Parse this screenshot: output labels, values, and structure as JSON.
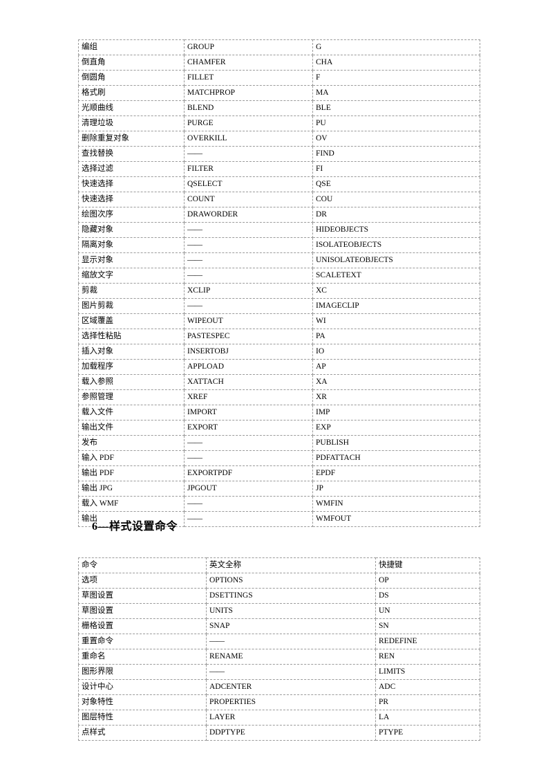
{
  "document": {
    "page_background": "#ffffff",
    "border_color": "#9a9a9a",
    "text_color": "#000000",
    "empty_cell_marker": "——"
  },
  "table_one": {
    "name": "continued-command-table",
    "columns": [
      "command_cn",
      "english_full_name",
      "shortcut"
    ],
    "rows": [
      {
        "cn": "编组",
        "en": "GROUP",
        "key": "G"
      },
      {
        "cn": "倒直角",
        "en": "CHAMFER",
        "key": "CHA"
      },
      {
        "cn": "倒圆角",
        "en": "FILLET",
        "key": "F"
      },
      {
        "cn": "格式刷",
        "en": "MATCHPROP",
        "key": "MA"
      },
      {
        "cn": "光顺曲线",
        "en": "BLEND",
        "key": "BLE"
      },
      {
        "cn": "清理垃圾",
        "en": "PURGE",
        "key": "PU"
      },
      {
        "cn": "删除重复对象",
        "en": "OVERKILL",
        "key": "OV"
      },
      {
        "cn": "查找替换",
        "en": "——",
        "key": "FIND"
      },
      {
        "cn": "选择过滤",
        "en": "FILTER",
        "key": "FI"
      },
      {
        "cn": "快速选择",
        "en": "QSELECT",
        "key": "QSE"
      },
      {
        "cn": "快速选择",
        "en": "COUNT",
        "key": "COU"
      },
      {
        "cn": "绘图次序",
        "en": "DRAWORDER",
        "key": "DR"
      },
      {
        "cn": "隐藏对象",
        "en": "——",
        "key": "HIDEOBJECTS"
      },
      {
        "cn": "隔离对象",
        "en": "——",
        "key": "ISOLATEOBJECTS"
      },
      {
        "cn": "显示对象",
        "en": "——",
        "key": "UNISOLATEOBJECTS"
      },
      {
        "cn": "缩放文字",
        "en": "——",
        "key": "SCALETEXT"
      },
      {
        "cn": "剪裁",
        "en": "XCLIP",
        "key": "XC"
      },
      {
        "cn": "图片剪裁",
        "en": "——",
        "key": "IMAGECLIP"
      },
      {
        "cn": "区域覆盖",
        "en": "WIPEOUT",
        "key": "WI"
      },
      {
        "cn": "选择性粘贴",
        "en": "PASTESPEC",
        "key": "PA"
      },
      {
        "cn": "插入对象",
        "en": "INSERTOBJ",
        "key": "IO"
      },
      {
        "cn": "加载程序",
        "en": "APPLOAD",
        "key": "AP"
      },
      {
        "cn": "载入参照",
        "en": "XATTACH",
        "key": "XA"
      },
      {
        "cn": "参照管理",
        "en": "XREF",
        "key": "XR"
      },
      {
        "cn": "载入文件",
        "en": "IMPORT",
        "key": "IMP"
      },
      {
        "cn": "输出文件",
        "en": "EXPORT",
        "key": "EXP"
      },
      {
        "cn": "发布",
        "en": "——",
        "key": "PUBLISH"
      },
      {
        "cn": "输入 PDF",
        "en": "——",
        "key": "PDFATTACH"
      },
      {
        "cn": "输出 PDF",
        "en": "EXPORTPDF",
        "key": "EPDF"
      },
      {
        "cn": "输出 JPG",
        "en": "JPGOUT",
        "key": "JP"
      },
      {
        "cn": "载入 WMF",
        "en": "——",
        "key": "WMFIN"
      },
      {
        "cn": "输出",
        "en": "——",
        "key": "WMFOUT"
      }
    ]
  },
  "section_heading": {
    "text": "6—样式设置命令"
  },
  "table_two": {
    "name": "style-settings-command-table",
    "header": {
      "cn": "命令",
      "en": "英文全称",
      "key": "快捷键"
    },
    "rows": [
      {
        "cn": "选项",
        "en": "OPTIONS",
        "key": "OP"
      },
      {
        "cn": "草图设置",
        "en": "DSETTINGS",
        "key": "DS"
      },
      {
        "cn": "草图设置",
        "en": "UNITS",
        "key": "UN"
      },
      {
        "cn": "栅格设置",
        "en": "SNAP",
        "key": "SN"
      },
      {
        "cn": "重置命令",
        "en": "——",
        "key": "REDEFINE"
      },
      {
        "cn": "重命名",
        "en": "RENAME",
        "key": "REN"
      },
      {
        "cn": "图形界限",
        "en": "——",
        "key": "LIMITS"
      },
      {
        "cn": "设计中心",
        "en": "ADCENTER",
        "key": "ADC"
      },
      {
        "cn": "对象特性",
        "en": "PROPERTIES",
        "key": "PR"
      },
      {
        "cn": "图层特性",
        "en": "LAYER",
        "key": "LA"
      },
      {
        "cn": "点样式",
        "en": "DDPTYPE",
        "key": "PTYPE"
      }
    ]
  }
}
